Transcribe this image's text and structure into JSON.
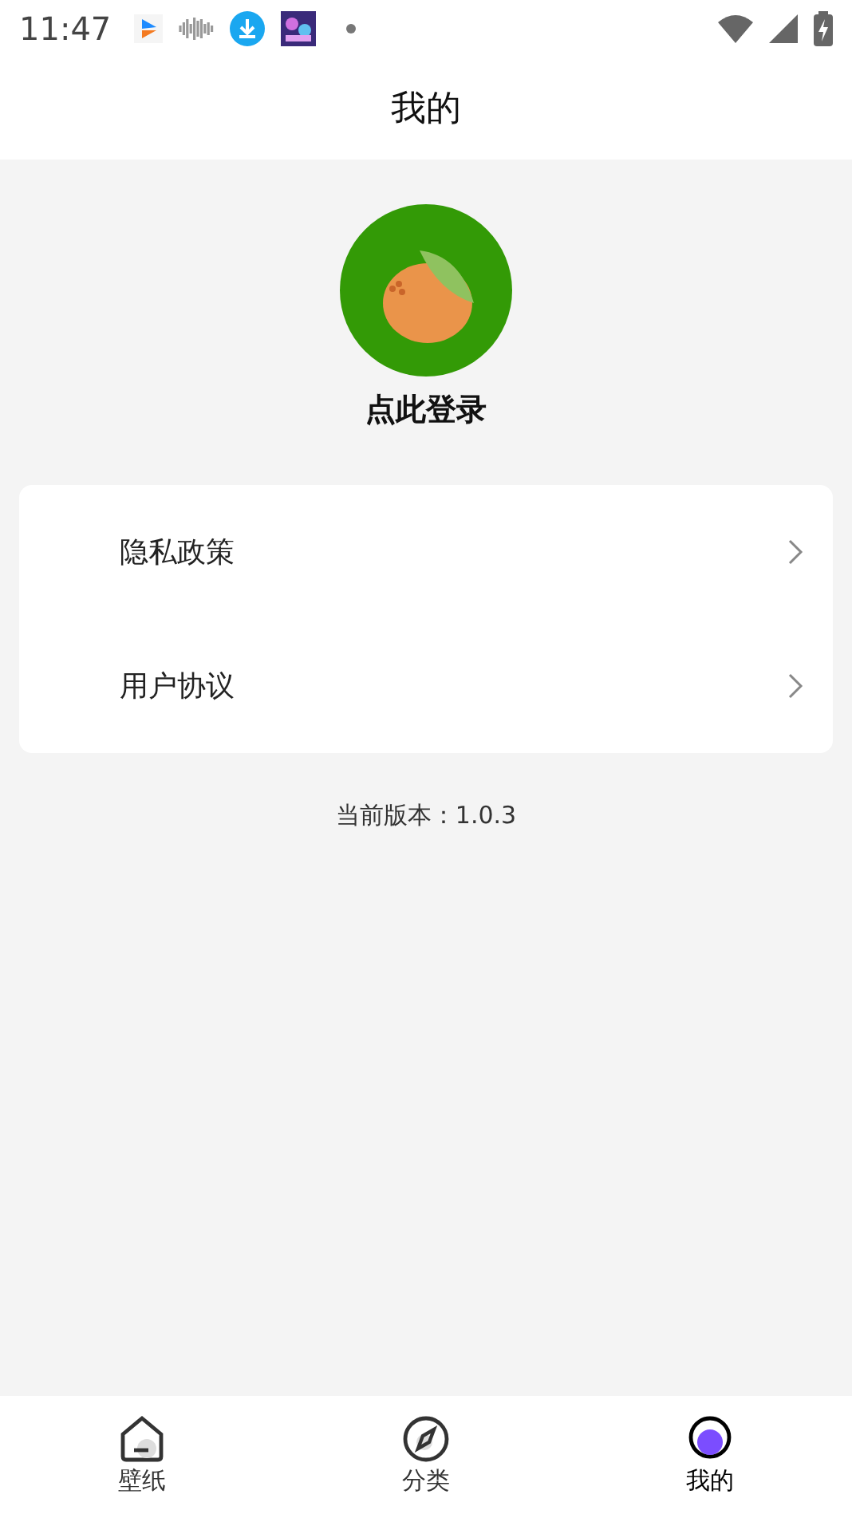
{
  "status_bar": {
    "time": "11:47"
  },
  "header": {
    "title": "我的"
  },
  "profile": {
    "login": "点此登录"
  },
  "menu": [
    {
      "label": "隐私政策"
    },
    {
      "label": "用户协议"
    }
  ],
  "version": "当前版本：1.0.3",
  "tabs": [
    {
      "kind": "home",
      "label": "壁纸",
      "selected": false
    },
    {
      "kind": "compass",
      "label": "分类",
      "selected": false
    },
    {
      "kind": "profile",
      "label": "我的",
      "selected": true
    }
  ]
}
